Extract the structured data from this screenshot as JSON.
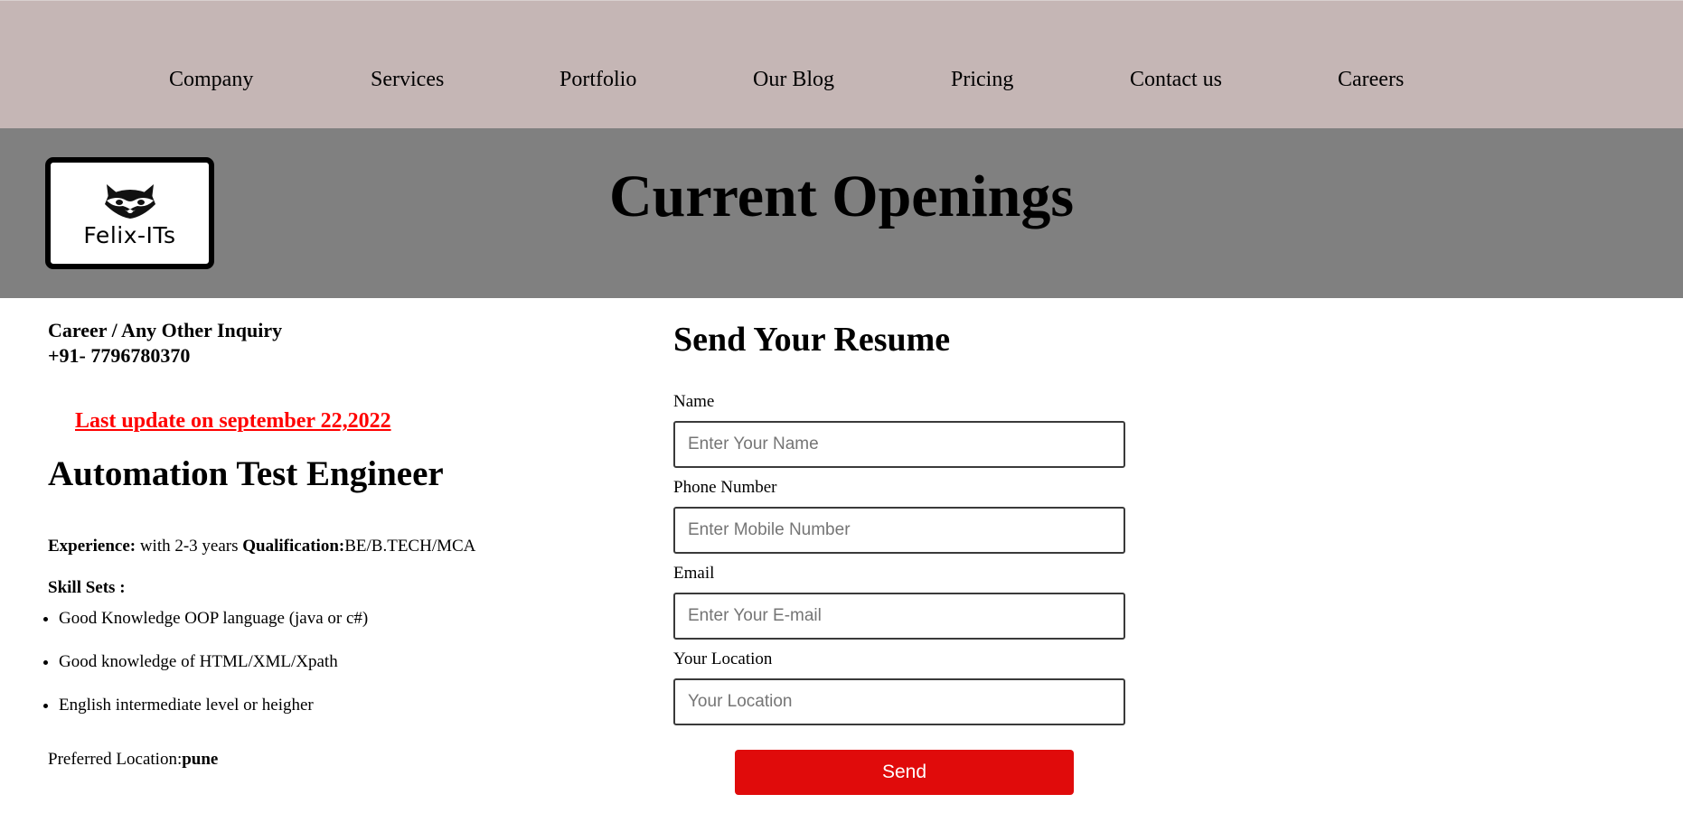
{
  "nav": {
    "items": [
      {
        "label": "Company"
      },
      {
        "label": "Services"
      },
      {
        "label": "Portfolio"
      },
      {
        "label": "Our Blog"
      },
      {
        "label": "Pricing"
      },
      {
        "label": "Contact us"
      },
      {
        "label": "Careers"
      }
    ]
  },
  "header": {
    "logo_text": "Felix-ITs",
    "logo_icon": "raccoon-icon",
    "title": "Current Openings"
  },
  "contact": {
    "line1": "Career / Any Other Inquiry",
    "phone": "+91- 7796780370"
  },
  "job": {
    "last_update": "Last update on september 22,2022",
    "title": "Automation Test Engineer",
    "experience_label": "Experience:",
    "experience_value": " with 2-3 years ",
    "qualification_label": "Qualification:",
    "qualification_value": "BE/B.TECH/MCA",
    "skills_heading": "Skill Sets :",
    "skills": [
      "Good Knowledge OOP language (java or c#)",
      "Good knowledge of HTML/XML/Xpath",
      "English intermediate level or heigher"
    ],
    "location_label": "Preferred Location:",
    "location_value": "pune"
  },
  "form": {
    "title": "Send Your Resume",
    "fields": [
      {
        "label": "Name",
        "placeholder": "Enter Your Name"
      },
      {
        "label": "Phone Number",
        "placeholder": "Enter Mobile Number"
      },
      {
        "label": "Email",
        "placeholder": "Enter Your E-mail"
      },
      {
        "label": "Your Location",
        "placeholder": "Your Location"
      }
    ],
    "submit_label": "Send"
  },
  "colors": {
    "nav_bg": "#c5b6b5",
    "banner_bg": "#808080",
    "accent_red": "#e00b0b",
    "update_red": "#ff0000"
  }
}
